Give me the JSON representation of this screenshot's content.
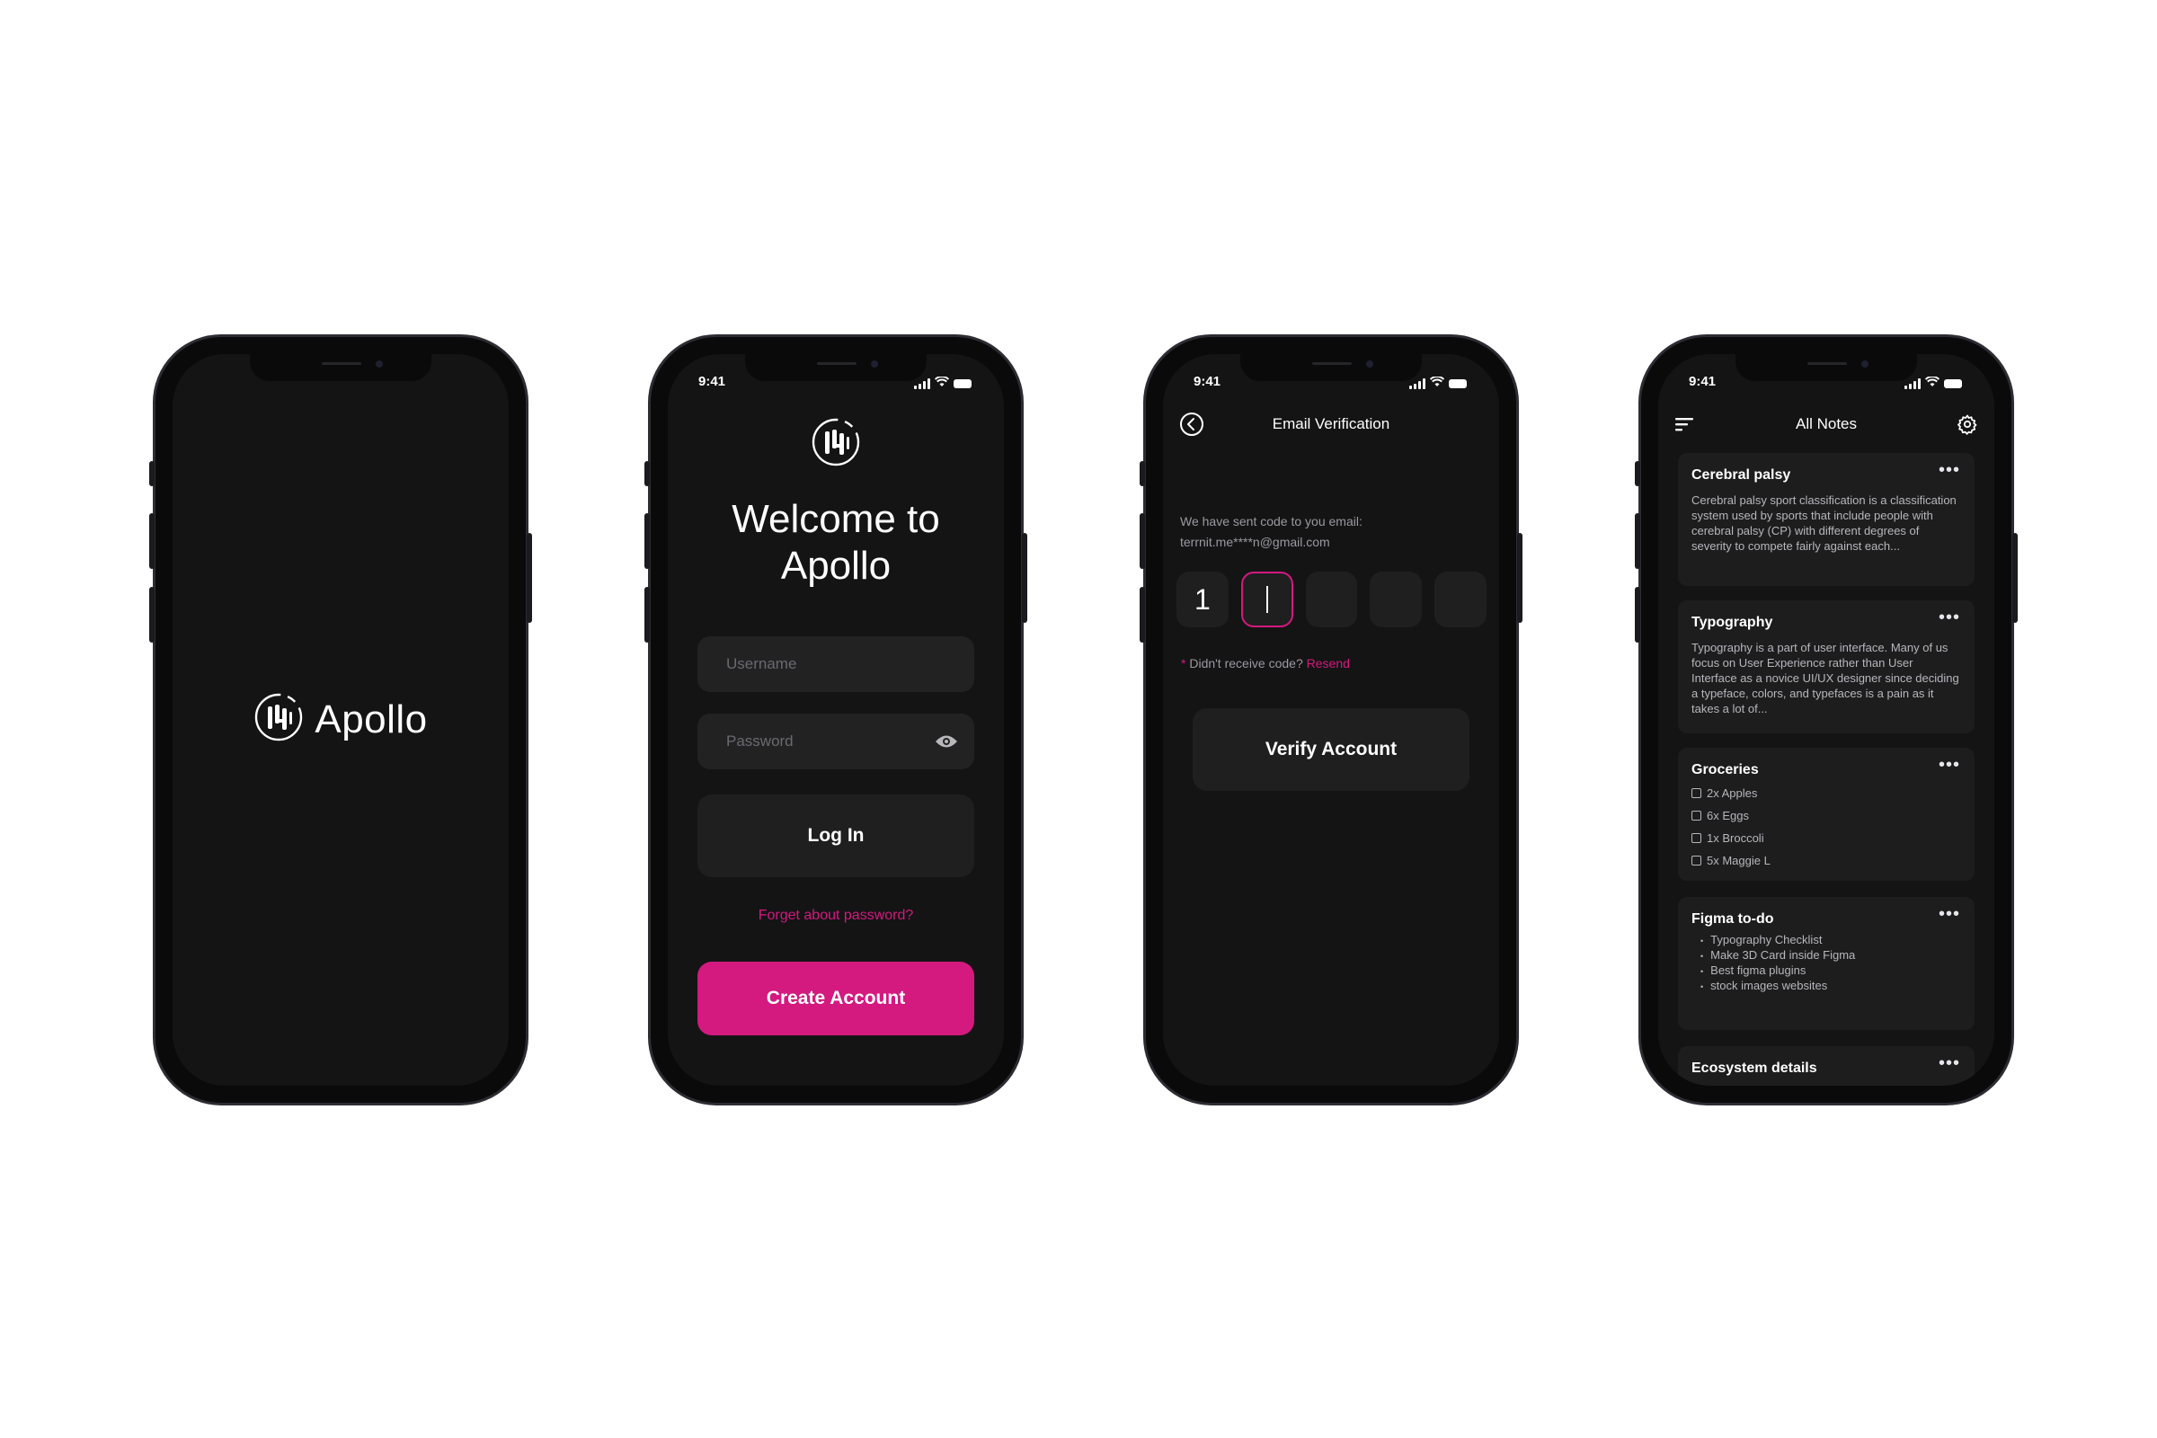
{
  "colors": {
    "accent": "#d4197f",
    "screen_bg": "#141415",
    "surface": "#1f1f20"
  },
  "splash": {
    "app_name": "Apollo"
  },
  "login": {
    "status_time": "9:41",
    "welcome_line1": "Welcome to",
    "welcome_line2": "Apollo",
    "username_placeholder": "Username",
    "password_placeholder": "Password",
    "login_label": "Log In",
    "forgot_label": "Forget about password?",
    "create_label": "Create Account"
  },
  "verify": {
    "status_time": "9:41",
    "title": "Email Verification",
    "sent_text": "We have sent code to you email:",
    "email": "terrnit.me****n@gmail.com",
    "otp_digits": [
      "1",
      "",
      "",
      "",
      ""
    ],
    "resend_prefix": "*",
    "resend_question": " Didn't receive code? ",
    "resend_link": "Resend",
    "verify_label": "Verify Account"
  },
  "notes": {
    "status_time": "9:41",
    "title": "All Notes",
    "cards": [
      {
        "title": "Cerebral palsy",
        "body": "Cerebral palsy sport classification is a classification system used by sports that include people with cerebral palsy (CP) with different degrees of severity to compete fairly against each..."
      },
      {
        "title": "Typography",
        "body": "Typography is a part of user interface. Many of us focus on User Experience rather than User Interface as a novice UI/UX designer since deciding a typeface, colors, and typefaces is a pain as it takes a lot of..."
      },
      {
        "title": "Groceries",
        "items": [
          "2x Apples",
          "6x Eggs",
          "1x Broccoli",
          "5x Maggie L"
        ]
      },
      {
        "title": "Figma to-do",
        "bullets": [
          "Typography Checklist",
          "Make 3D Card inside Figma",
          "Best figma plugins",
          "stock images websites"
        ]
      },
      {
        "title": "Ecosystem details"
      }
    ]
  }
}
